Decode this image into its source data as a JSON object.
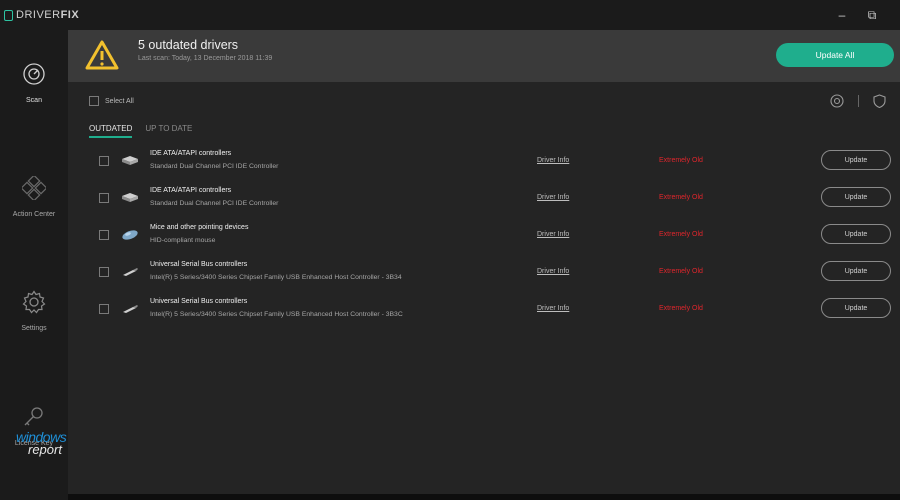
{
  "app": {
    "logo_prefix": "DRIVER",
    "logo_suffix": "FIX",
    "minimize_glyph": "–",
    "restore_glyph": "⧉"
  },
  "sidebar": {
    "items": [
      {
        "label": "Scan",
        "icon": "scan-icon",
        "active": true
      },
      {
        "label": "Action Center",
        "icon": "action-center-icon"
      },
      {
        "label": "Settings",
        "icon": "gear-icon"
      },
      {
        "label": "License Key",
        "icon": "key-icon"
      }
    ]
  },
  "watermark": {
    "line1": "windows",
    "line2": "report"
  },
  "banner": {
    "title": "5 outdated drivers",
    "subtitle": "Last scan: Today, 13 December 2018 11:39",
    "update_all": "Update All",
    "warning_icon": "warning-icon"
  },
  "toolbar": {
    "select_all": "Select All",
    "icons": [
      "settings-circle-icon",
      "shield-icon"
    ]
  },
  "tabs": [
    {
      "label": "OUTDATED",
      "active": true
    },
    {
      "label": "UP TO DATE",
      "active": false
    }
  ],
  "drivers": [
    {
      "name": "IDE ATA/ATAPI controllers",
      "desc": "Standard Dual Channel PCI IDE Controller",
      "info": "Driver Info",
      "status": "Extremely Old",
      "action": "Update",
      "icon": "controller-icon"
    },
    {
      "name": "IDE ATA/ATAPI controllers",
      "desc": "Standard Dual Channel PCI IDE Controller",
      "info": "Driver Info",
      "status": "Extremely Old",
      "action": "Update",
      "icon": "controller-icon"
    },
    {
      "name": "Mice and other pointing devices",
      "desc": "HID-compliant mouse",
      "info": "Driver Info",
      "status": "Extremely Old",
      "action": "Update",
      "icon": "mouse-icon"
    },
    {
      "name": "Universal Serial Bus controllers",
      "desc": "Intel(R) 5 Series/3400 Series Chipset Family USB Enhanced Host Controller - 3B34",
      "info": "Driver Info",
      "status": "Extremely Old",
      "action": "Update",
      "icon": "usb-icon"
    },
    {
      "name": "Universal Serial Bus controllers",
      "desc": "Intel(R) 5 Series/3400 Series Chipset Family USB Enhanced Host Controller - 3B3C",
      "info": "Driver Info",
      "status": "Extremely Old",
      "action": "Update",
      "icon": "usb-icon"
    }
  ],
  "colors": {
    "accent": "#1fae8d",
    "status_old": "#e0262c",
    "warning": "#f2c12e"
  }
}
